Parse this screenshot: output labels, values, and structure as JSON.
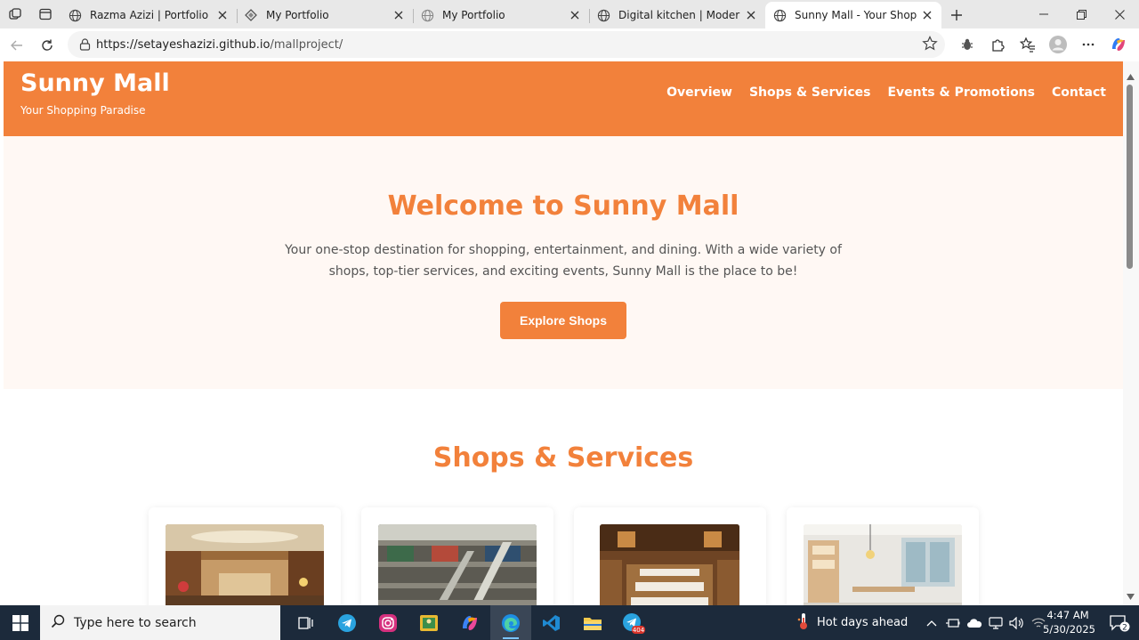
{
  "browser": {
    "tabs": [
      {
        "title": "Razma Azizi | Portfolio",
        "active": false
      },
      {
        "title": "My Portfolio",
        "active": false
      },
      {
        "title": "My Portfolio",
        "active": false
      },
      {
        "title": "Digital kitchen | Modern Culi",
        "active": false
      },
      {
        "title": "Sunny Mall - Your Shopping",
        "active": true
      }
    ],
    "url_host": "https://setayeshazizi.github.io",
    "url_path": "/mallproject/"
  },
  "site": {
    "brand_title": "Sunny Mall",
    "brand_tagline": "Your Shopping Paradise",
    "nav": [
      "Overview",
      "Shops & Services",
      "Events & Promotions",
      "Contact"
    ],
    "accent_color": "#f2813b"
  },
  "hero": {
    "heading": "Welcome to Sunny Mall",
    "body": "Your one-stop destination for shopping, entertainment, and dining. With a wide variety of shops, top-tier services, and exciting events, Sunny Mall is the place to be!",
    "cta_label": "Explore Shops"
  },
  "shops": {
    "heading": "Shops & Services"
  },
  "taskbar": {
    "search_placeholder": "Type here to search",
    "weather_text": "Hot days ahead",
    "time": "4:47 AM",
    "date": "5/30/2025",
    "telegram_badge": "404",
    "notification_count": "2"
  }
}
